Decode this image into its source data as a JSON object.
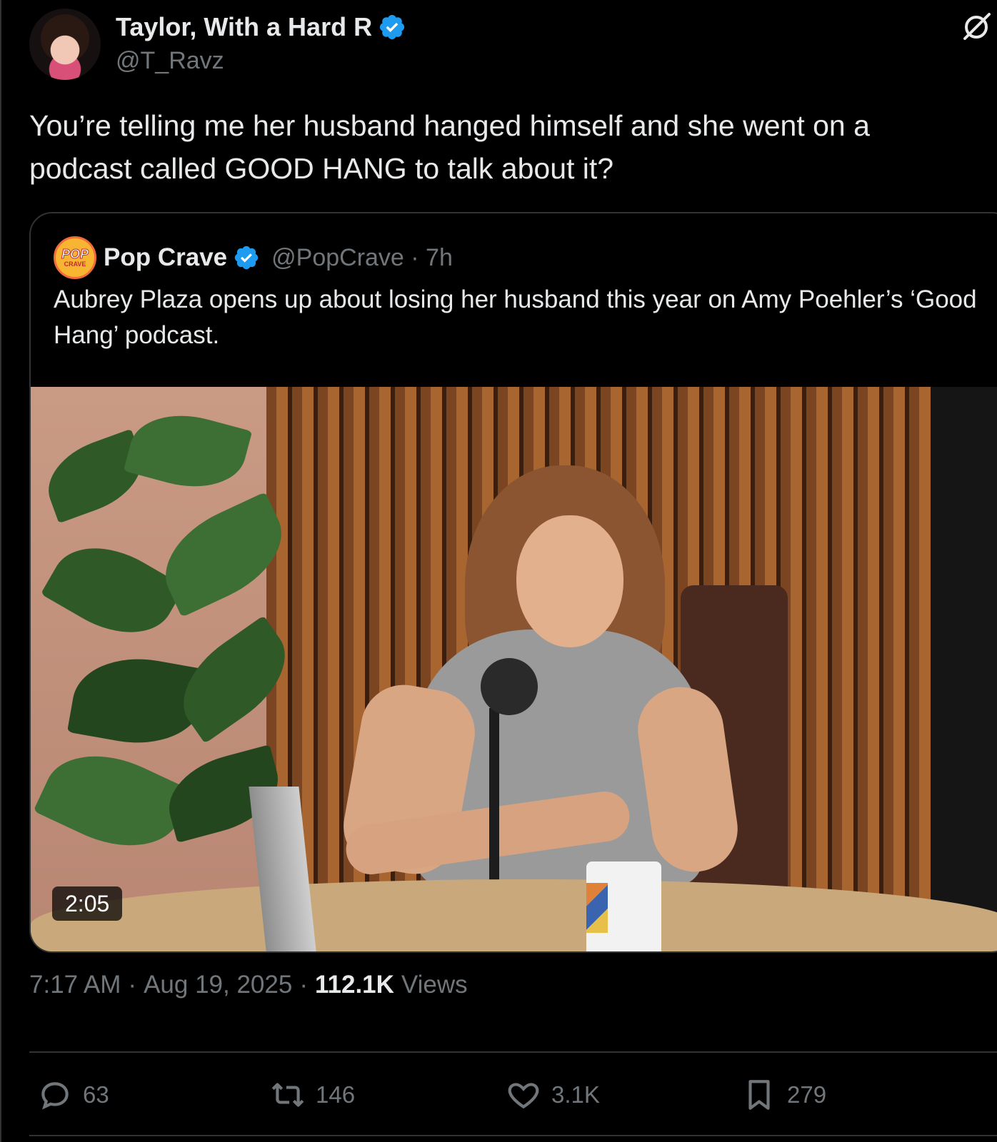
{
  "author": {
    "display_name": "Taylor, With a Hard R",
    "handle": "@T_Ravz",
    "verified": true
  },
  "tweet": {
    "text": "You’re telling me her husband hanged himself and she went on a podcast called GOOD HANG to talk about it?"
  },
  "quote": {
    "display_name": "Pop Crave",
    "handle_time": "@PopCrave · 7h",
    "avatar_text_top": "POP",
    "avatar_text_bottom": "CRAVE",
    "text": "Aubrey Plaza opens up about losing her husband this year on Amy Poehler’s ‘Good Hang’ podcast.",
    "video_duration": "2:05"
  },
  "meta": {
    "time": "7:17 AM",
    "date": "Aug 19, 2025",
    "views_count": "112.1K",
    "views_label": "Views",
    "separator": "·"
  },
  "actions": {
    "replies": "63",
    "reposts": "146",
    "likes": "3.1K",
    "bookmarks": "279"
  },
  "colors": {
    "background": "#000000",
    "text": "#e7e9ea",
    "muted": "#71767b",
    "verified": "#1d9bf0",
    "border": "#2f3336"
  },
  "icons": [
    "verified-badge-icon",
    "grok-icon",
    "reply-icon",
    "repost-icon",
    "like-icon",
    "bookmark-icon"
  ]
}
